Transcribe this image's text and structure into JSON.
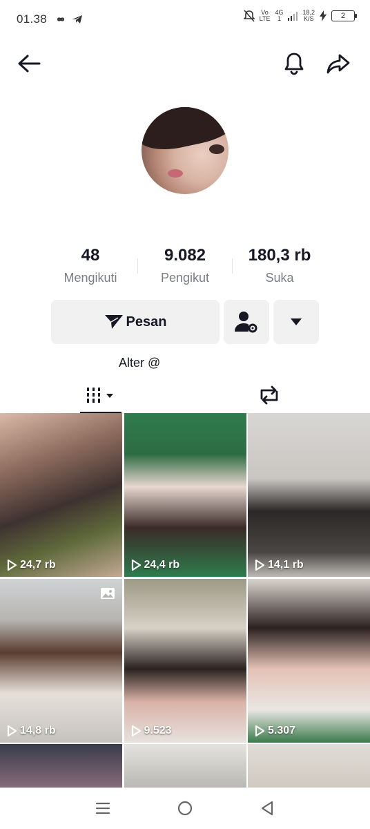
{
  "status_bar": {
    "time": "01.38",
    "volte": "Vo",
    "lte": "LTE",
    "net": "4G",
    "net_sub": "1",
    "speed": "18,2",
    "speed_unit": "K/S",
    "battery": "2"
  },
  "profile": {
    "stats": [
      {
        "value": "48",
        "label": "Mengikuti"
      },
      {
        "value": "9.082",
        "label": "Pengikut"
      },
      {
        "value": "180,3 rb",
        "label": "Suka"
      }
    ],
    "message_button": "Pesan",
    "bio": "Alter @"
  },
  "videos": [
    {
      "views": "24,7 rb",
      "color": "#8b6a5d"
    },
    {
      "views": "24,4 rb",
      "color": "#2f7c4d"
    },
    {
      "views": "14,1 rb",
      "color": "#2b2827"
    },
    {
      "views": "14,8 rb",
      "color": "#5a3d30",
      "photo": true
    },
    {
      "views": "9.523",
      "color": "#2a2220"
    },
    {
      "views": "5.307",
      "color": "#2c2220"
    }
  ],
  "icons": {
    "back": "arrow-left-icon",
    "bell": "bell-icon",
    "share": "share-icon",
    "send": "send-icon",
    "add_friend": "user-settings-icon",
    "dropdown": "caret-down-icon",
    "videos_tab": "grid-icon",
    "repost_tab": "repost-icon"
  }
}
